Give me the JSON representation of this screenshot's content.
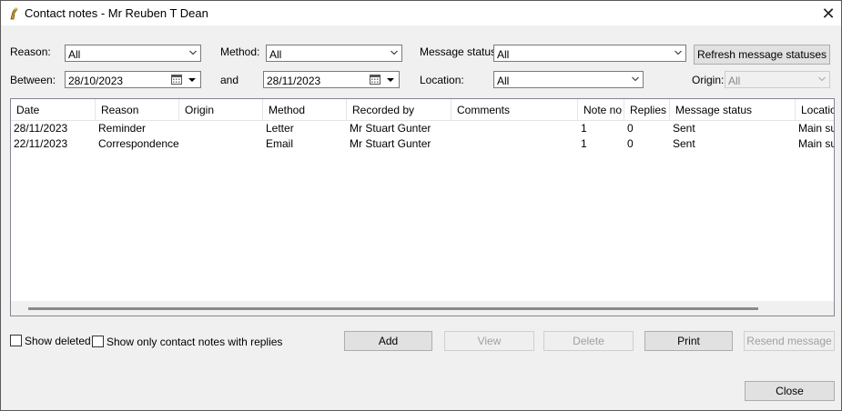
{
  "window": {
    "title": "Contact notes - Mr Reuben T Dean",
    "close_glyph": "✕"
  },
  "filters": {
    "reason_label": "Reason:",
    "reason_value": "All",
    "method_label": "Method:",
    "method_value": "All",
    "message_status_label": "Message status:",
    "message_status_value": "All",
    "refresh_button": "Refresh message statuses",
    "between_label": "Between:",
    "between_value": "28/10/2023",
    "and_label": "and",
    "and_value": "28/11/2023",
    "location_label": "Location:",
    "location_value": "All",
    "origin_label": "Origin:",
    "origin_value": "All"
  },
  "table": {
    "columns": [
      "Date",
      "Reason",
      "Origin",
      "Method",
      "Recorded by",
      "Comments",
      "Note no",
      "Replies",
      "Message status",
      "Location"
    ],
    "rows": [
      [
        "28/11/2023",
        "Reminder",
        "",
        "Letter",
        "Mr Stuart Gunter",
        "",
        "1",
        "0",
        "Sent",
        "Main surgery"
      ],
      [
        "22/11/2023",
        "Correspondence Out",
        "",
        "Email",
        "Mr Stuart Gunter",
        "",
        "1",
        "0",
        "Sent",
        "Main surgery"
      ]
    ]
  },
  "options": {
    "show_deleted": "Show deleted",
    "show_replies": "Show only contact notes with replies"
  },
  "actions": {
    "add": "Add",
    "view": "View",
    "delete": "Delete",
    "print": "Print",
    "resend": "Resend message",
    "close": "Close"
  }
}
